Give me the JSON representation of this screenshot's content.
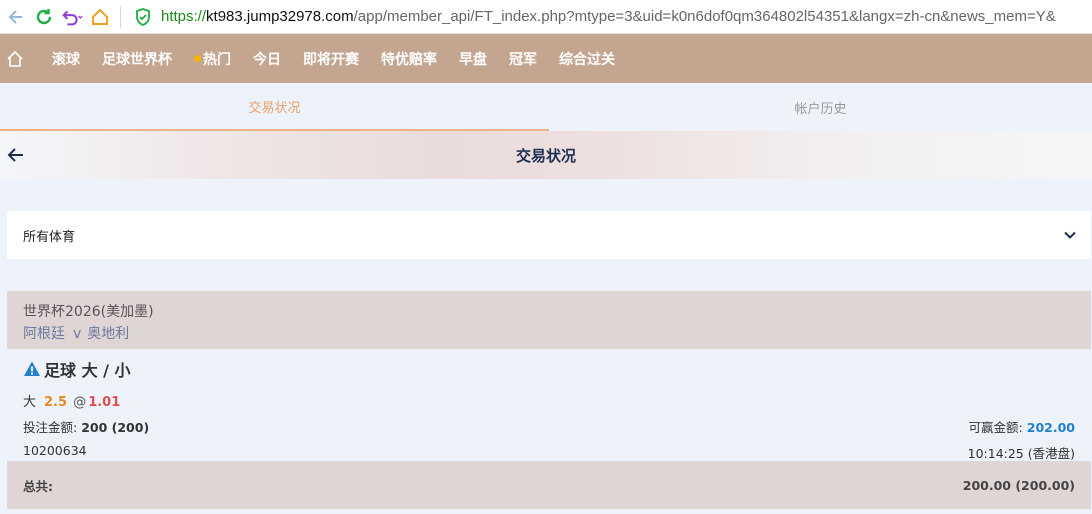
{
  "browser": {
    "url_proto": "https://",
    "url_host": "kt983.jump32978.com",
    "url_rest": "/app/member_api/FT_index.php?mtype=3&uid=k0n6dof0qm364802l54351&langx=zh-cn&news_mem=Y&"
  },
  "nav": {
    "items": [
      "滚球",
      "足球世界杯",
      "热门",
      "今日",
      "即将开赛",
      "特优赔率",
      "早盘",
      "冠军",
      "综合过关"
    ]
  },
  "tabs": {
    "active": "交易状况",
    "inactive": "帐户历史"
  },
  "page": {
    "title": "交易状况"
  },
  "filter": {
    "label": "所有体育"
  },
  "bet": {
    "league": "世界杯2026(美加墨)",
    "team_home": "阿根廷",
    "vs": "v",
    "team_away": "奥地利",
    "bet_type": "足球 大 / 小",
    "selection": "大",
    "line": "2.5",
    "at": "@",
    "odds": "1.01",
    "stake_label": "投注金额:",
    "stake_value": "200 (200)",
    "win_label": "可赢金额:",
    "win_value": "202.00",
    "ticket_id": "10200634",
    "time": "10:14:25 (香港盘)"
  },
  "total": {
    "label": "总共:",
    "value": "200.00 (200.00)"
  },
  "colors": {
    "nav_bg": "#c4a690",
    "active_tab": "#e8a06a",
    "line_orange": "#e58a1f",
    "odds_red": "#e05050",
    "win_blue": "#1f7fd0"
  }
}
